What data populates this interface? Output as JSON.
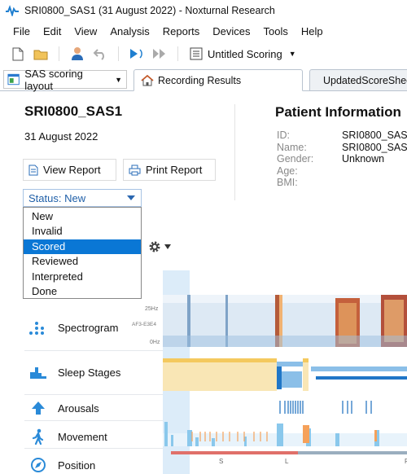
{
  "window": {
    "title": "SRI0800_SAS1 (31 August 2022) - Noxturnal Research"
  },
  "menu": [
    "File",
    "Edit",
    "View",
    "Analysis",
    "Reports",
    "Devices",
    "Tools",
    "Help"
  ],
  "toolbar": {
    "scoring_label": "Untitled Scoring"
  },
  "tabs": {
    "layout_label": "SAS scoring layout",
    "active_tab": "Recording Results",
    "second_tab": "UpdatedScoreSheet"
  },
  "recording": {
    "id": "SRI0800_SAS1",
    "date": "31 August 2022",
    "view_report_label": "View Report",
    "print_report_label": "Print Report"
  },
  "patient": {
    "title": "Patient Information",
    "fields": [
      {
        "label": "ID:",
        "value": "SRI0800_SAS"
      },
      {
        "label": "Name:",
        "value": "SRI0800_SAS"
      },
      {
        "label": "Gender:",
        "value": "Unknown"
      },
      {
        "label": "Age:",
        "value": ""
      },
      {
        "label": "BMI:",
        "value": ""
      }
    ]
  },
  "status": {
    "current": "Status: New",
    "options": [
      "New",
      "Invalid",
      "Scored",
      "Reviewed",
      "Interpreted",
      "Done"
    ],
    "highlighted": "Scored"
  },
  "signals": {
    "rows": [
      "Spectrogram",
      "Sleep Stages",
      "Arousals",
      "Movement",
      "Position"
    ],
    "spectrogram_axis": [
      "25Hz",
      "AF3-E3E4",
      "0Hz"
    ],
    "position_axis": [
      "S",
      "L",
      "R"
    ]
  },
  "colors": {
    "accent": "#0a77d5",
    "icon_blue": "#2a8ad8",
    "sleep_wake": "#f9e6b5",
    "sleep_rem": "#f4c95e",
    "sleep_n": "#8bbfe8",
    "sleep_deep": "#2076c7",
    "arousal": "#1c6fbf",
    "movement": "#8ac8ec",
    "movement_event": "#f5a15a",
    "position_bar": "#e0706a"
  }
}
